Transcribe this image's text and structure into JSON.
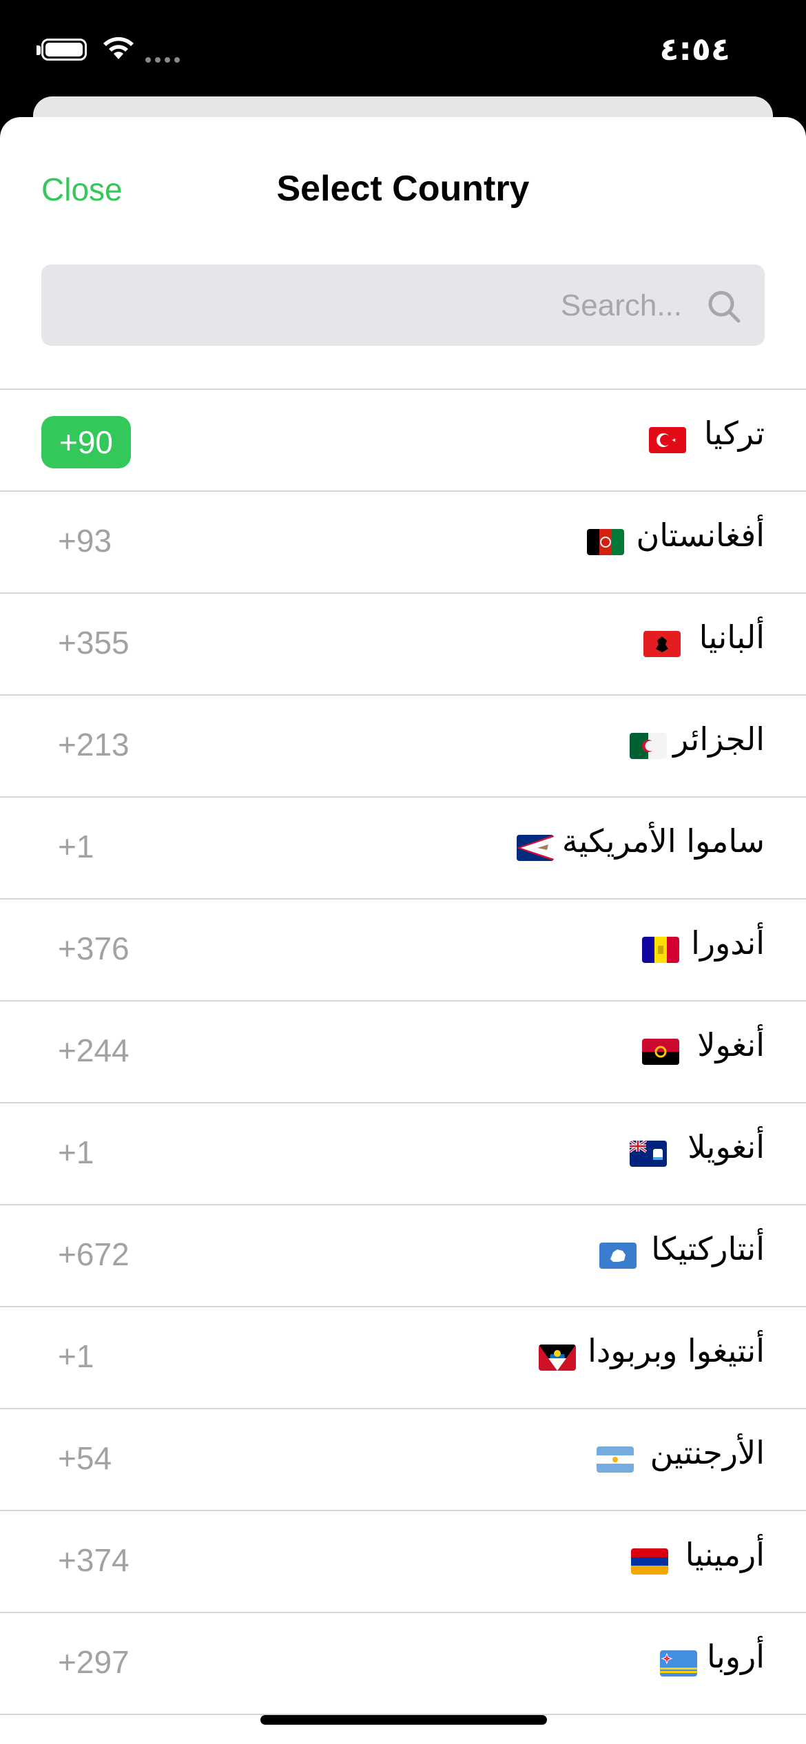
{
  "status_bar": {
    "time": "٤:٥٤"
  },
  "header": {
    "close_label": "Close",
    "title": "Select Country"
  },
  "search": {
    "placeholder": "Search..."
  },
  "colors": {
    "accent": "#34c759",
    "secondary_text": "#a1a1a6",
    "separator": "#d6d6d8",
    "search_bg": "#e6e6ea"
  },
  "countries": [
    {
      "name": "تركيا",
      "code": "+90",
      "selected": true,
      "flag": "turkey-flag-icon"
    },
    {
      "name": "أفغانستان",
      "code": "+93",
      "selected": false,
      "flag": "afghanistan-flag-icon"
    },
    {
      "name": "ألبانيا",
      "code": "+355",
      "selected": false,
      "flag": "albania-flag-icon"
    },
    {
      "name": "الجزائر",
      "code": "+213",
      "selected": false,
      "flag": "algeria-flag-icon"
    },
    {
      "name": "ساموا الأمريكية",
      "code": "+1",
      "selected": false,
      "flag": "american-samoa-flag-icon"
    },
    {
      "name": "أندورا",
      "code": "+376",
      "selected": false,
      "flag": "andorra-flag-icon"
    },
    {
      "name": "أنغولا",
      "code": "+244",
      "selected": false,
      "flag": "angola-flag-icon"
    },
    {
      "name": "أنغويلا",
      "code": "+1",
      "selected": false,
      "flag": "anguilla-flag-icon"
    },
    {
      "name": "أنتاركتيكا",
      "code": "+672",
      "selected": false,
      "flag": "antarctica-flag-icon"
    },
    {
      "name": "أنتيغوا وبربودا",
      "code": "+1",
      "selected": false,
      "flag": "antigua-flag-icon"
    },
    {
      "name": "الأرجنتين",
      "code": "+54",
      "selected": false,
      "flag": "argentina-flag-icon"
    },
    {
      "name": "أرمينيا",
      "code": "+374",
      "selected": false,
      "flag": "armenia-flag-icon"
    },
    {
      "name": "أروبا",
      "code": "+297",
      "selected": false,
      "flag": "aruba-flag-icon"
    }
  ]
}
